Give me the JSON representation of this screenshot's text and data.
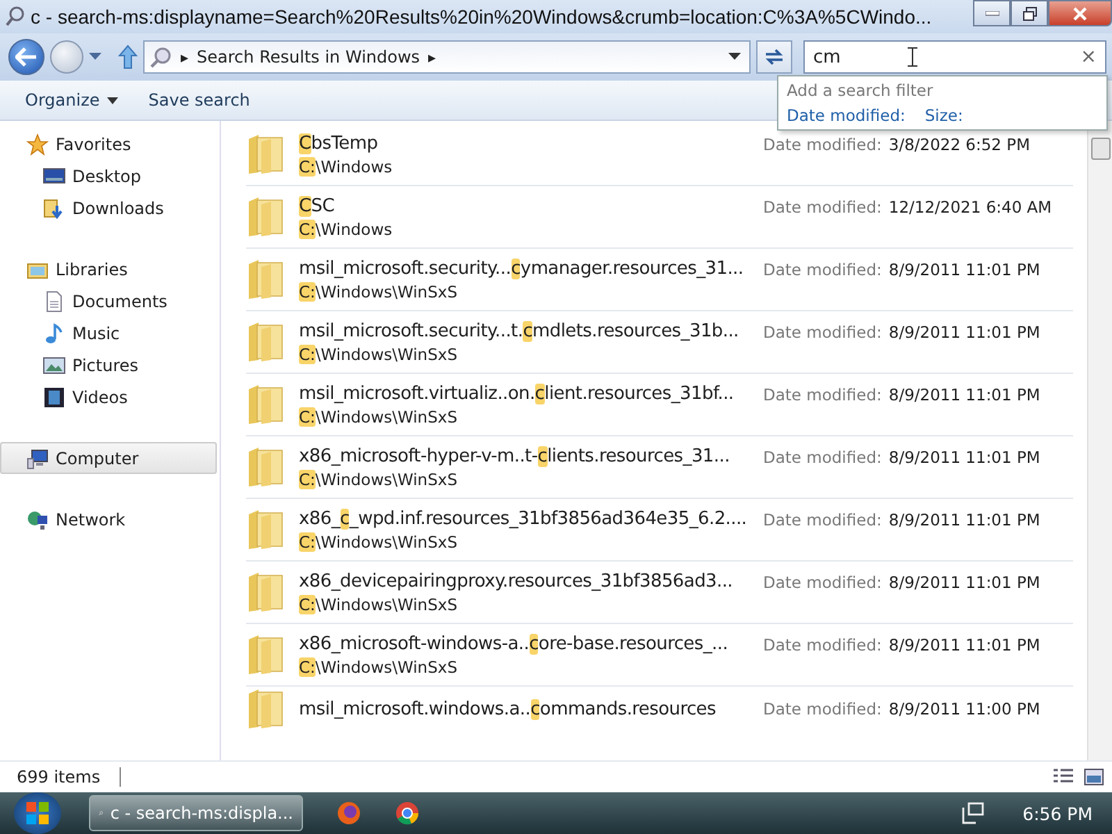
{
  "window": {
    "title": "c - search-ms:displayname=Search%20Results%20in%20Windows&crumb=location:C%3A%5CWindo..."
  },
  "address": {
    "arrow_left": "▸",
    "location": "Search Results in Windows",
    "arrow_right": "▸"
  },
  "search": {
    "value": "cm",
    "clear": "×"
  },
  "search_popup": {
    "heading": "Add a search filter",
    "filters": [
      "Date modified:",
      "Size:"
    ]
  },
  "toolbar": [
    {
      "label": "Organize",
      "dropdown": true
    },
    {
      "label": "Save search",
      "dropdown": false
    }
  ],
  "sidebar": {
    "groups": [
      {
        "label": "Favorites",
        "selected": false,
        "children": [
          {
            "label": "Desktop",
            "selected": false
          },
          {
            "label": "Downloads",
            "selected": false
          }
        ]
      },
      {
        "label": "Libraries",
        "selected": false,
        "children": [
          {
            "label": "Documents",
            "selected": false
          },
          {
            "label": "Music",
            "selected": false
          },
          {
            "label": "Pictures",
            "selected": false
          },
          {
            "label": "Videos",
            "selected": false
          }
        ]
      },
      {
        "label": "Computer",
        "selected": true
      },
      {
        "label": "Network",
        "selected": false
      }
    ]
  },
  "results": [
    {
      "match": "C",
      "after": "bsTemp",
      "path_match": "C:",
      "path_after": "\\Windows",
      "date_label": "Date modified:",
      "date": "3/8/2022 6:52 PM"
    },
    {
      "match": "C",
      "after": "SC",
      "path_match": "C:",
      "path_after": "\\Windows",
      "date_label": "Date modified:",
      "date": "12/12/2021 6:40 AM"
    },
    {
      "before": "msil_microsoft.security...",
      "match": "c",
      "after": "ymanager.resources_31...",
      "path_match": "C:",
      "path_after": "\\Windows\\WinSxS",
      "date_label": "Date modified:",
      "date": "8/9/2011 11:01 PM"
    },
    {
      "before": "msil_microsoft.security...t.",
      "match": "c",
      "after": "mdlets.resources_31b...",
      "path_match": "C:",
      "path_after": "\\Windows\\WinSxS",
      "date_label": "Date modified:",
      "date": "8/9/2011 11:01 PM"
    },
    {
      "before": "msil_microsoft.virtualiz..on.",
      "match": "c",
      "after": "lient.resources_31bf...",
      "path_match": "C:",
      "path_after": "\\Windows\\WinSxS",
      "date_label": "Date modified:",
      "date": "8/9/2011 11:01 PM"
    },
    {
      "before": "x86_microsoft-hyper-v-m..t-",
      "match": "c",
      "after": "lients.resources_31...",
      "path_match": "C:",
      "path_after": "\\Windows\\WinSxS",
      "date_label": "Date modified:",
      "date": "8/9/2011 11:01 PM"
    },
    {
      "before": "x86_",
      "match": "c",
      "after": "_wpd.inf.resources_31bf3856ad364e35_6.2....",
      "path_match": "C:",
      "path_after": "\\Windows\\WinSxS",
      "date_label": "Date modified:",
      "date": "8/9/2011 11:01 PM"
    },
    {
      "before": "x86_devicepairingproxy.resources_31bf3856ad3...",
      "path_match": "C:",
      "path_after": "\\Windows\\WinSxS",
      "date_label": "Date modified:",
      "date": "8/9/2011 11:01 PM"
    },
    {
      "before": "x86_microsoft-windows-a..",
      "match": "c",
      "after": "ore-base.resources_...",
      "path_match": "C:",
      "path_after": "\\Windows\\WinSxS",
      "date_label": "Date modified:",
      "date": "8/9/2011 11:01 PM"
    },
    {
      "before": "msil_microsoft.windows.a..",
      "match": "c",
      "after": "ommands.resources",
      "date_label": "Date modified:",
      "date": "8/9/2011 11:00 PM"
    }
  ],
  "status_bar": {
    "count": "699 items"
  },
  "taskbar": {
    "window_button": "c - search-ms:displa...",
    "clock": "6:56 PM"
  }
}
